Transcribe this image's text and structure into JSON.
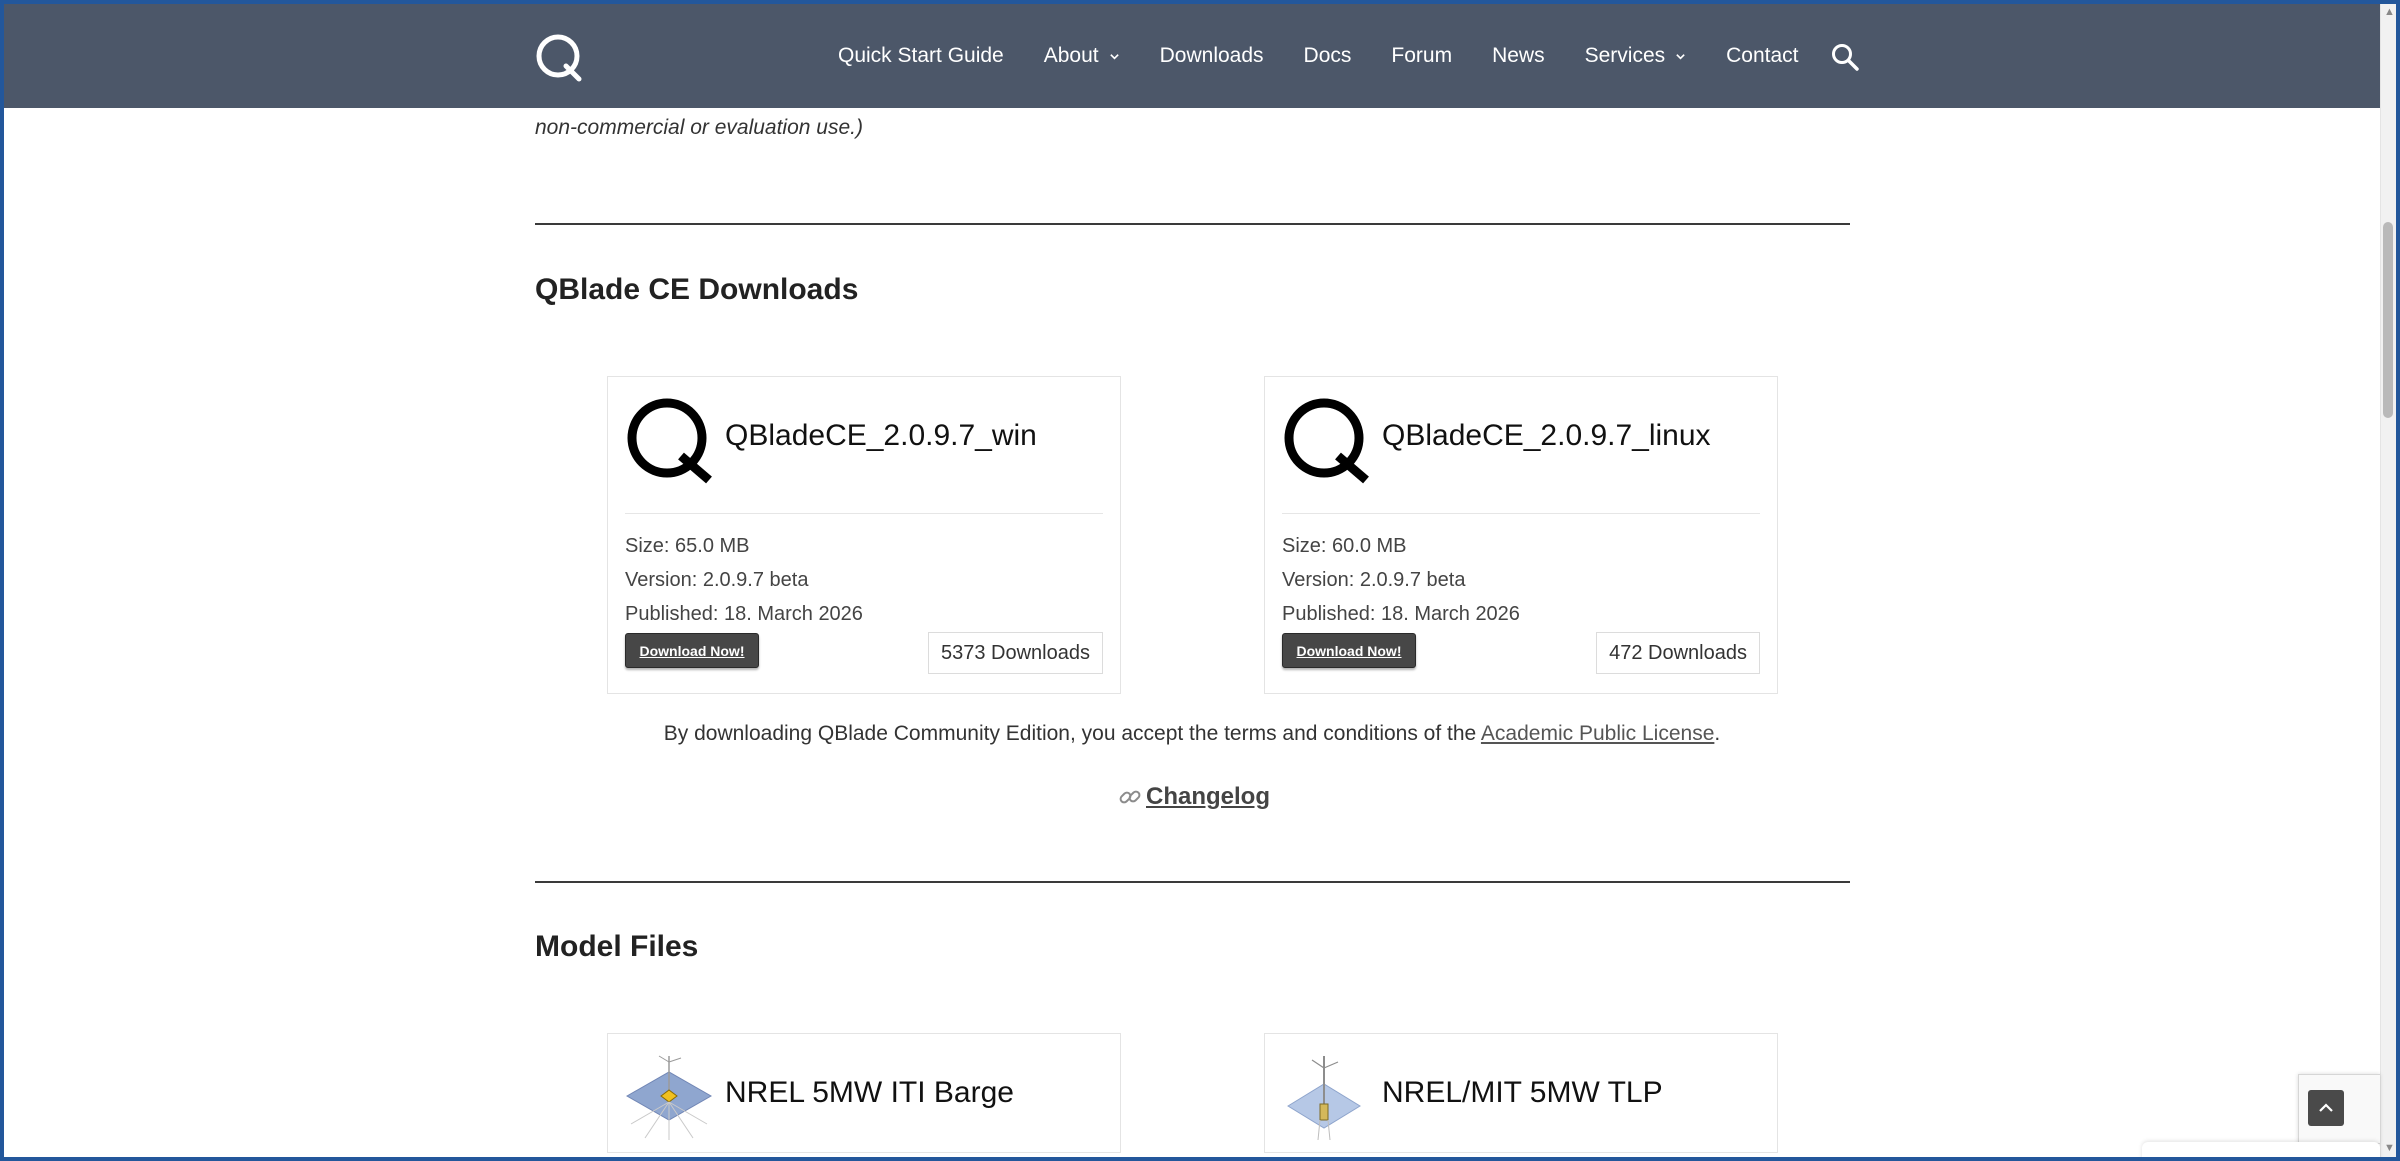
{
  "header": {
    "logo_alt": "QBlade logo",
    "nav": [
      {
        "label": "Quick Start Guide",
        "has_dropdown": false
      },
      {
        "label": "About",
        "has_dropdown": true
      },
      {
        "label": "Downloads",
        "has_dropdown": false
      },
      {
        "label": "Docs",
        "has_dropdown": false
      },
      {
        "label": "Forum",
        "has_dropdown": false
      },
      {
        "label": "News",
        "has_dropdown": false
      },
      {
        "label": "Services",
        "has_dropdown": true
      },
      {
        "label": "Contact",
        "has_dropdown": false
      }
    ],
    "header_bg": "#4c5769"
  },
  "intro": {
    "tail_text": "non-commercial or evaluation use.)"
  },
  "ce_section": {
    "title": "QBlade CE Downloads",
    "cards": [
      {
        "name": "QBladeCE_2.0.9.7_win",
        "size": "Size: 65.0 MB",
        "version": "Version: 2.0.9.7 beta",
        "published": "Published: 18. March 2026",
        "button_label": "Download Now!",
        "downloads": "5373 Downloads"
      },
      {
        "name": "QBladeCE_2.0.9.7_linux",
        "size": "Size: 60.0 MB",
        "version": "Version: 2.0.9.7 beta",
        "published": "Published: 18. March 2026",
        "button_label": "Download Now!",
        "downloads": "472 Downloads"
      }
    ],
    "license_prefix": "By downloading QBlade Community Edition, you accept the terms and conditions of the",
    "license_link": "Academic Public License",
    "license_suffix": ".",
    "changelog_label": "Changelog"
  },
  "model_section": {
    "title": "Model Files",
    "cards": [
      {
        "name": "NREL 5MW ITI Barge"
      },
      {
        "name": "NREL/MIT 5MW TLP"
      }
    ]
  },
  "colors": {
    "frame": "#23579b",
    "button": "#474747",
    "text": "#2b2b2b"
  }
}
